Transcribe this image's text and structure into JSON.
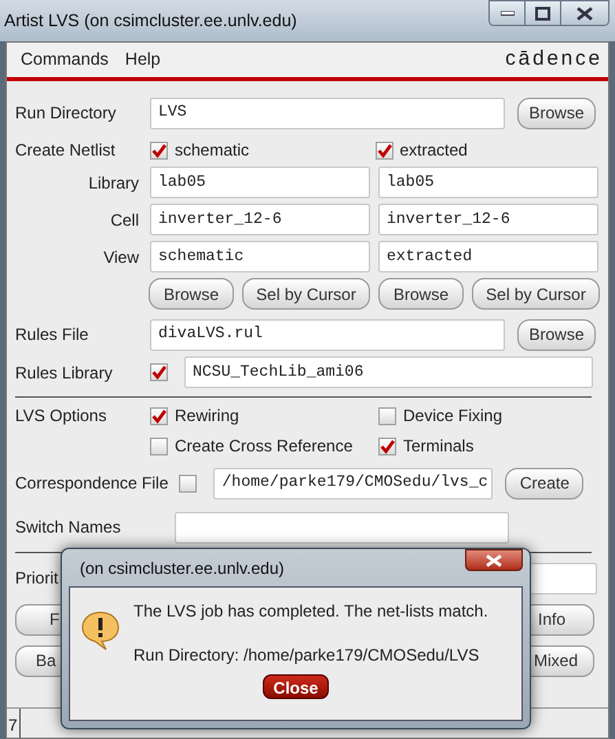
{
  "window": {
    "title": "Artist LVS (on csimcluster.ee.unlv.edu)"
  },
  "menu": [
    {
      "label": "Commands"
    },
    {
      "label": "Help"
    }
  ],
  "logo": "cādence",
  "run_directory": {
    "label": "Run Directory",
    "value": "LVS",
    "button": "Browse"
  },
  "create_netlist": {
    "label": "Create Netlist",
    "row_labels": [
      "Library",
      "Cell",
      "View"
    ],
    "columns": [
      {
        "label": "schematic",
        "checked": true,
        "library": "lab05",
        "cell": "inverter_12-6",
        "view": "schematic",
        "buttons": [
          "Browse",
          "Sel by Cursor"
        ]
      },
      {
        "label": "extracted",
        "checked": true,
        "library": "lab05",
        "cell": "inverter_12-6",
        "view": "extracted",
        "buttons": [
          "Browse",
          "Sel by Cursor"
        ]
      }
    ]
  },
  "rules_file": {
    "label": "Rules File",
    "value": "divaLVS.rul",
    "button": "Browse"
  },
  "rules_library": {
    "label": "Rules Library",
    "checked": true,
    "value": "NCSU_TechLib_ami06"
  },
  "lvs_options": {
    "label": "LVS Options",
    "options": [
      {
        "label": "Rewiring",
        "checked": true
      },
      {
        "label": "Device Fixing",
        "checked": false
      },
      {
        "label": "Create Cross Reference",
        "checked": false
      },
      {
        "label": "Terminals",
        "checked": true
      }
    ]
  },
  "correspondence_file": {
    "label": "Correspondence File",
    "checked": false,
    "value": "/home/parke179/CMOSedu/lvs_c",
    "button": "Create"
  },
  "switch_names": {
    "label": "Switch Names"
  },
  "priority": {
    "label": "Priorit"
  },
  "buttons_row_1": [
    "F",
    "Info"
  ],
  "buttons_row_2": [
    "Ba",
    "Mixed"
  ],
  "status_bar": {
    "text": "7"
  },
  "dialog": {
    "title": "(on csimcluster.ee.unlv.edu)",
    "message": "The LVS job has completed. The net-lists match.",
    "detail": "Run Directory: /home/parke179/CMOSedu/LVS",
    "button": "Close"
  }
}
